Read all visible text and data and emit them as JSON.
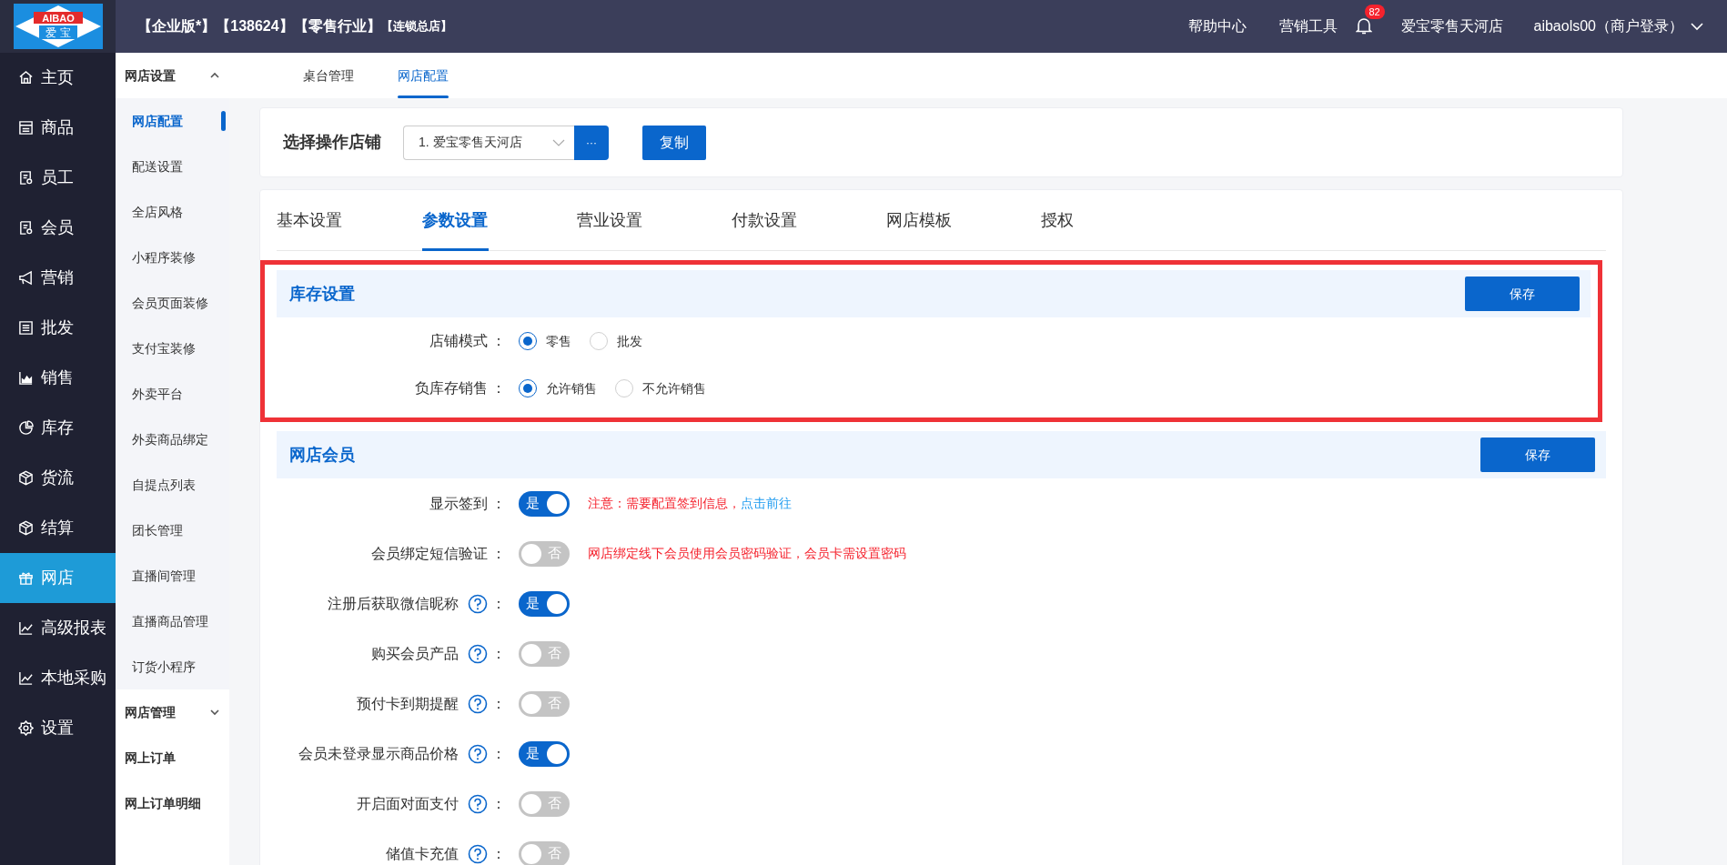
{
  "header": {
    "logo": {
      "latin": "AIBAO",
      "chinese": "爱 宝"
    },
    "title_parts": [
      {
        "text": "【企业版*】",
        "kind": "main"
      },
      {
        "text": "【138624】",
        "kind": "main"
      },
      {
        "text": "【零售行业】",
        "kind": "main"
      },
      {
        "text": "【连锁总店】",
        "kind": "tag"
      }
    ],
    "links": [
      "帮助中心",
      "营销工具"
    ],
    "notifications": "82",
    "store": "爱宝零售天河店",
    "user": "aibaols00（商户登录）"
  },
  "main_nav": [
    {
      "label": "主页",
      "selected": false
    },
    {
      "label": "商品",
      "selected": false
    },
    {
      "label": "员工",
      "selected": false
    },
    {
      "label": "会员",
      "selected": false
    },
    {
      "label": "营销",
      "selected": false
    },
    {
      "label": "批发",
      "selected": false
    },
    {
      "label": "销售",
      "selected": false
    },
    {
      "label": "库存",
      "selected": false
    },
    {
      "label": "货流",
      "selected": false
    },
    {
      "label": "结算",
      "selected": false
    },
    {
      "label": "网店",
      "selected": true
    },
    {
      "label": "高级报表",
      "selected": false
    },
    {
      "label": "本地采购",
      "selected": false
    },
    {
      "label": "设置",
      "selected": false
    }
  ],
  "sub_nav": [
    {
      "label": "网店设置",
      "kind": "group",
      "expanded": true,
      "children": [
        {
          "label": "网店配置",
          "selected": true
        },
        {
          "label": "配送设置",
          "selected": false
        },
        {
          "label": "全店风格",
          "selected": false
        },
        {
          "label": "小程序装修",
          "selected": false
        },
        {
          "label": "会员页面装修",
          "selected": false
        },
        {
          "label": "支付宝装修",
          "selected": false
        },
        {
          "label": "外卖平台",
          "selected": false
        },
        {
          "label": "外卖商品绑定",
          "selected": false
        },
        {
          "label": "自提点列表",
          "selected": false
        },
        {
          "label": "团长管理",
          "selected": false
        },
        {
          "label": "直播间管理",
          "selected": false
        },
        {
          "label": "直播商品管理",
          "selected": false
        },
        {
          "label": "订货小程序",
          "selected": false
        }
      ]
    },
    {
      "label": "网店管理",
      "kind": "group",
      "expanded": false
    },
    {
      "label": "网上订单",
      "kind": "link"
    },
    {
      "label": "网上订单明细",
      "kind": "link"
    }
  ],
  "page_tabs": [
    {
      "label": "桌台管理",
      "selected": false
    },
    {
      "label": "网店配置",
      "selected": true
    }
  ],
  "store_picker": {
    "label": "选择操作店铺",
    "value": "1. 爱宝零售天河店",
    "more_button": "···",
    "copy_button": "复制"
  },
  "settings_tabs": [
    {
      "label": "基本设置",
      "selected": false
    },
    {
      "label": "参数设置",
      "selected": true
    },
    {
      "label": "营业设置",
      "selected": false
    },
    {
      "label": "付款设置",
      "selected": false
    },
    {
      "label": "网店模板",
      "selected": false
    },
    {
      "label": "授权",
      "selected": false
    }
  ],
  "sections": [
    {
      "title": "库存设置",
      "save_button": "保存",
      "highlighted": true,
      "rows": [
        {
          "kind": "radio",
          "label": "店铺模式",
          "colon": "：",
          "options": [
            {
              "label": "零售",
              "selected": true
            },
            {
              "label": "批发",
              "selected": false
            }
          ]
        },
        {
          "kind": "radio",
          "label": "负库存销售",
          "colon": "：",
          "options": [
            {
              "label": "允许销售",
              "selected": true
            },
            {
              "label": "不允许销售",
              "selected": false
            }
          ]
        }
      ]
    },
    {
      "title": "网店会员",
      "save_button": "保存",
      "highlighted": false,
      "rows": [
        {
          "kind": "toggle",
          "label": "显示签到",
          "colon": "：",
          "help": false,
          "on": true,
          "toggle_text": "是",
          "note": "注意：需要配置签到信息，",
          "note_link": "点击前往"
        },
        {
          "kind": "toggle",
          "label": "会员绑定短信验证",
          "colon": "：",
          "help": false,
          "on": false,
          "toggle_text": "否",
          "note": "网店绑定线下会员使用会员密码验证，会员卡需设置密码"
        },
        {
          "kind": "toggle",
          "label": "注册后获取微信昵称",
          "colon": "：",
          "help": true,
          "on": true,
          "toggle_text": "是"
        },
        {
          "kind": "toggle",
          "label": "购买会员产品",
          "colon": "：",
          "help": true,
          "on": false,
          "toggle_text": "否"
        },
        {
          "kind": "toggle",
          "label": "预付卡到期提醒",
          "colon": "：",
          "help": true,
          "on": false,
          "toggle_text": "否"
        },
        {
          "kind": "toggle",
          "label": "会员未登录显示商品价格",
          "colon": "：",
          "help": true,
          "on": true,
          "toggle_text": "是"
        },
        {
          "kind": "toggle",
          "label": "开启面对面支付",
          "colon": "：",
          "help": true,
          "on": false,
          "toggle_text": "否"
        },
        {
          "kind": "toggle",
          "label": "储值卡充值",
          "colon": "：",
          "help": true,
          "on": false,
          "toggle_text": "否"
        }
      ]
    }
  ]
}
